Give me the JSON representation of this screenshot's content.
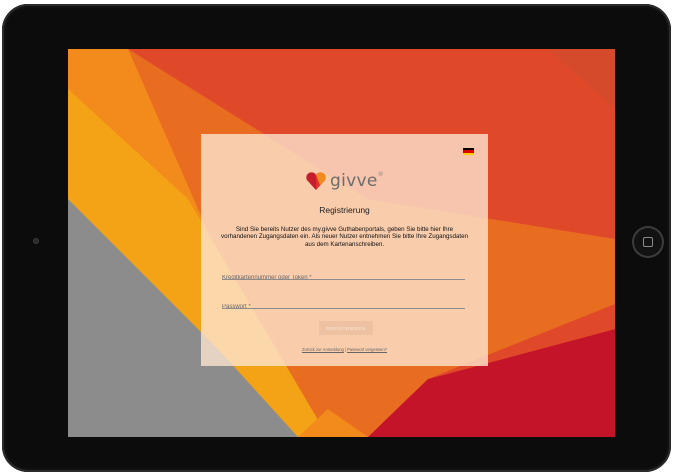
{
  "device": {
    "home_button_icon": "home-square-icon",
    "camera_icon": "front-camera-icon"
  },
  "wallpaper": {
    "colors": [
      "#e86d20",
      "#e0482a",
      "#f28a1c",
      "#f5a316",
      "#8c8c8c",
      "#c4142a",
      "#d44a2a"
    ]
  },
  "card": {
    "language_flag": "german-flag-icon",
    "logo": {
      "icon": "givve-heart-logo-icon",
      "wordmark": "givve",
      "trademark": "®"
    },
    "title": "Registrierung",
    "intro": "Sind Sie bereits Nutzer des my.givve Guthabenportals, geben Sie bitte hier Ihre vorhandenen Zugangsdaten ein. Als neuer Nutzer entnehmen Sie bitte Ihre Zugangsdaten aus dem Kartenanschreiben.",
    "fields": {
      "token": {
        "placeholder": "Kreditkartennummer oder Token *",
        "value": ""
      },
      "password": {
        "placeholder": "Passwort *",
        "value": ""
      }
    },
    "submit_label": "REGISTRIEREN",
    "links": {
      "back": "Zurück zur Anmeldung",
      "separator": "|",
      "forgot": "Passwort vergessen?"
    }
  }
}
